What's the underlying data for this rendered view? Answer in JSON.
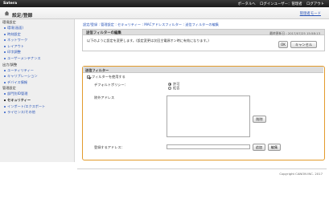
{
  "topbar": {
    "brand": "Satera",
    "links": [
      "ポータルへ",
      "ログインユーザー：管理者",
      "ログアウト"
    ]
  },
  "header": {
    "title": "設定/登録",
    "portal_link": "管理者モード"
  },
  "sidebar": {
    "sections": [
      {
        "label": "環境設定",
        "items": [
          "環境(画面)",
          "時刻設定",
          "ネットワーク",
          "レイアウト",
          "印字調整",
          "ユーザーメンテナンス"
        ]
      },
      {
        "label": "出力/調整",
        "items": [
          "ユーティリティー",
          "キャリブレーション",
          "デバイス情報"
        ]
      },
      {
        "label": "管理設定",
        "items": [
          "部門別ID管理",
          "セキュリティー",
          "インポート/エクスポート",
          "ライセンス/その他"
        ],
        "active_index": 1
      }
    ]
  },
  "main": {
    "breadcrumb": "設定/登録 : 管理設定 : セキュリティー : MACアドレスフィルター : 送信フィルターの編集",
    "edit_header": {
      "title": "送信フィルターの編集",
      "timestamp": "最終更新日 : 2017/07/25 15:58:13"
    },
    "notice": "以下のように設定を変更します。(設定変更は次回主電源オン時に有効になります。)",
    "ok_label": "OK",
    "cancel_label": "キャンセル",
    "filter": {
      "section_title": "送信フィルター",
      "use_filter_label": "フィルターを使用する",
      "use_filter_checked": true,
      "default_policy_label": "デフォルトポリシー：",
      "allow_label": "許可",
      "deny_label": "拒否",
      "selected_policy": "allow",
      "except_label": "除外アドレス",
      "except_addresses": [],
      "delete_label": "削除",
      "register_label": "登録するアドレス：",
      "register_value": "",
      "add_label": "追加",
      "edit_label": "編集"
    }
  },
  "footer": {
    "copyright": "Copyright CANON INC. 2017"
  }
}
